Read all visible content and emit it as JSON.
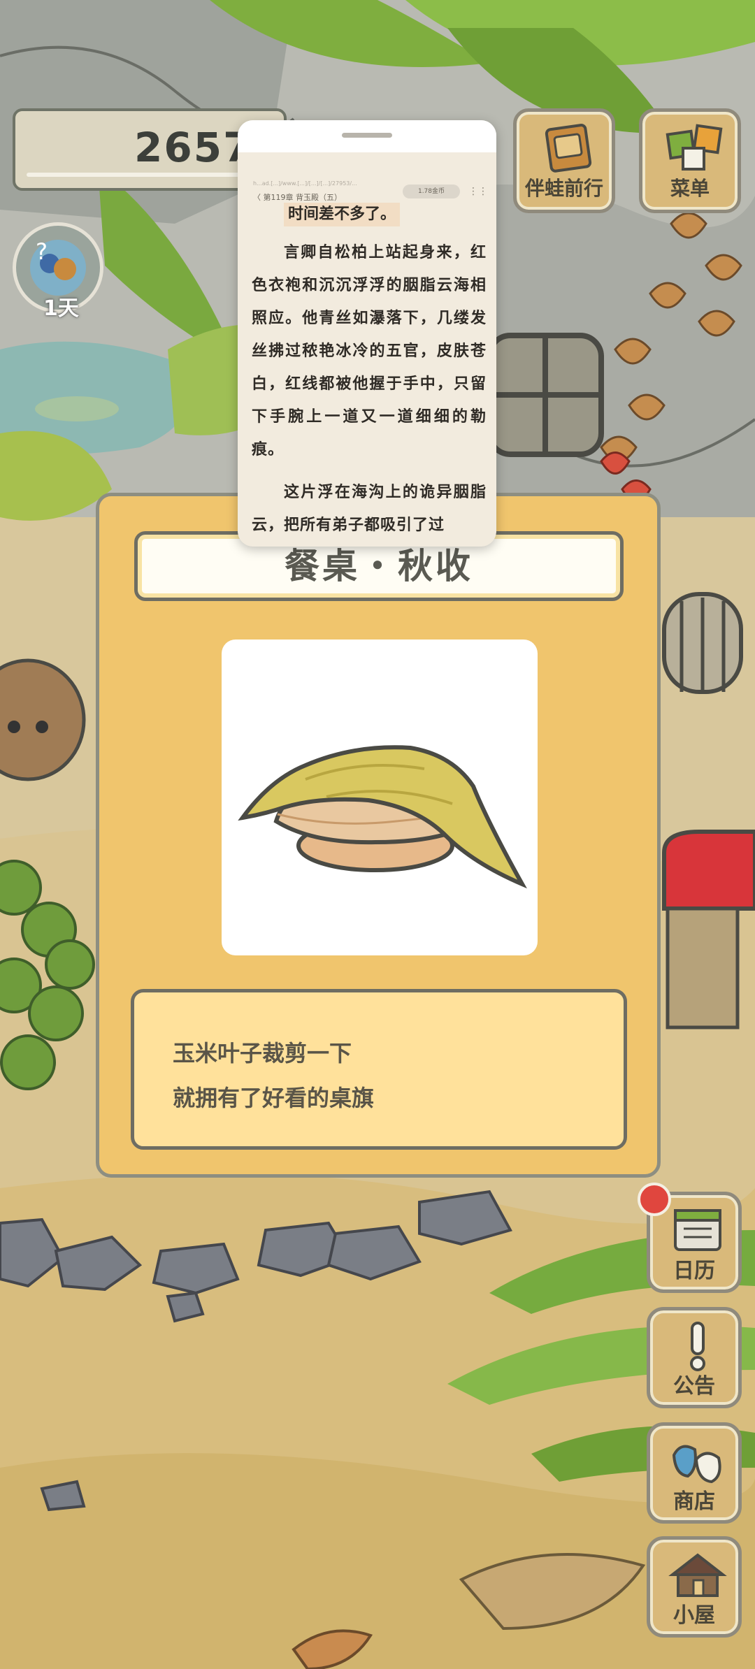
{
  "counter": {
    "value": "2657"
  },
  "day_badge": {
    "label": "1天"
  },
  "top_buttons": [
    {
      "label": "伴蛙前行",
      "icon": "journal-icon"
    },
    {
      "label": "菜单",
      "icon": "menu-cards-icon"
    }
  ],
  "side_buttons": [
    {
      "label": "日历",
      "icon": "calendar-icon"
    },
    {
      "label": "公告",
      "icon": "exclamation-icon"
    },
    {
      "label": "商店",
      "icon": "shop-bags-icon"
    },
    {
      "label": "小屋",
      "icon": "house-icon"
    }
  ],
  "item_card": {
    "title": "餐桌・秋收",
    "image": "corn-leaf-bread-icon",
    "desc_line1": "玉米叶子裁剪一下",
    "desc_line2": "就拥有了好看的桌旗"
  },
  "reader": {
    "url": "h...ad.[...]/www.[...]/[...]/[...]/27953/...",
    "chapter": "〈 第119章 背玉殿（五）",
    "coin": "1.78金币",
    "highlight": "时间差不多了。",
    "para1": "言卿自松柏上站起身来，红色衣袍和沉沉浮浮的胭脂云海相照应。他青丝如瀑落下，几缕发丝拂过秾艳冰冷的五官，皮肤苍白，红线都被他握于手中，只留下手腕上一道又一道细细的勒痕。",
    "para2": "这片浮在海沟上的诡异胭脂云，把所有弟子都吸引了过"
  },
  "colors": {
    "card_fill": "#f0c56d",
    "desc_fill": "#ffe19b",
    "wood": "#d9b97a",
    "notif": "#e0463e"
  }
}
